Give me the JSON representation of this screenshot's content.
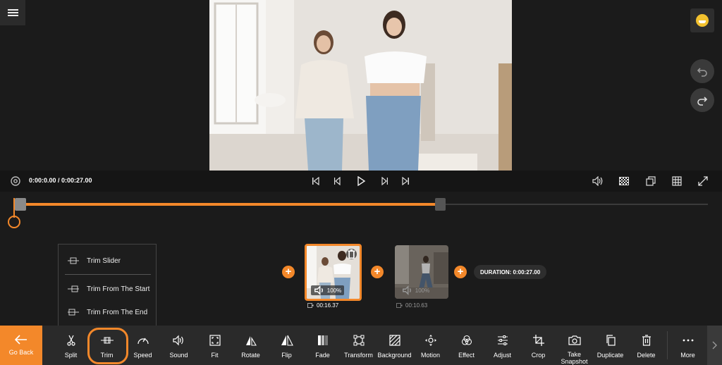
{
  "player": {
    "time": "0:00:0.00 / 0:00:27.00"
  },
  "trim_menu": {
    "items": [
      {
        "label": "Trim Slider"
      },
      {
        "label": "Trim From The Start"
      },
      {
        "label": "Trim From The End"
      }
    ]
  },
  "clips": [
    {
      "volume": "100%",
      "duration": "00:16.37",
      "selected": true
    },
    {
      "volume": "100%",
      "duration": "00:10.63",
      "selected": false
    }
  ],
  "duration_label": "DURATION: 0:00:27.00",
  "toolbar": {
    "go_back": "Go Back",
    "tools": [
      {
        "label": "Split",
        "icon": "scissors-icon"
      },
      {
        "label": "Trim",
        "icon": "trim-icon"
      },
      {
        "label": "Speed",
        "icon": "speedometer-icon"
      },
      {
        "label": "Sound",
        "icon": "speaker-icon"
      },
      {
        "label": "Fit",
        "icon": "fit-icon"
      },
      {
        "label": "Rotate",
        "icon": "rotate-icon"
      },
      {
        "label": "Flip",
        "icon": "flip-icon"
      },
      {
        "label": "Fade",
        "icon": "fade-icon"
      },
      {
        "label": "Transform",
        "icon": "transform-icon"
      },
      {
        "label": "Background",
        "icon": "background-icon"
      },
      {
        "label": "Motion",
        "icon": "motion-icon"
      },
      {
        "label": "Effect",
        "icon": "effect-icon"
      },
      {
        "label": "Adjust",
        "icon": "adjust-icon"
      },
      {
        "label": "Crop",
        "icon": "crop-icon"
      },
      {
        "label": "Take Snapshot",
        "icon": "camera-icon"
      },
      {
        "label": "Duplicate",
        "icon": "duplicate-icon"
      },
      {
        "label": "Delete",
        "icon": "trash-icon"
      },
      {
        "label": "More",
        "icon": "more-icon"
      }
    ]
  },
  "colors": {
    "accent": "#f3882a",
    "background": "#1b1b1b",
    "toolbar": "#2a2a2a"
  }
}
